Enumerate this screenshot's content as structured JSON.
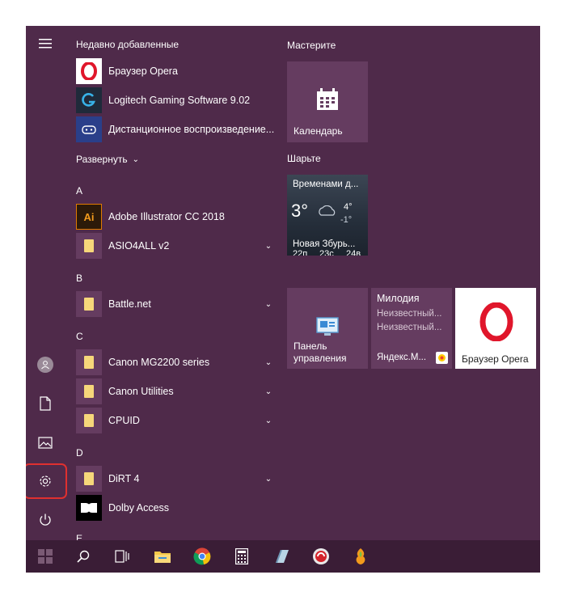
{
  "recent": {
    "heading": "Недавно добавленные",
    "items": [
      {
        "label": "Браузер Opera"
      },
      {
        "label": "Logitech Gaming Software 9.02"
      },
      {
        "label": "Дистанционное воспроизведение..."
      }
    ]
  },
  "expand_label": "Развернуть",
  "sections": [
    {
      "letter": "A",
      "items": [
        {
          "label": "Adobe Illustrator CC 2018"
        },
        {
          "label": "ASIO4ALL v2"
        }
      ]
    },
    {
      "letter": "B",
      "items": [
        {
          "label": "Battle.net"
        }
      ]
    },
    {
      "letter": "C",
      "items": [
        {
          "label": "Canon MG2200 series"
        },
        {
          "label": "Canon Utilities"
        },
        {
          "label": "CPUID"
        }
      ]
    },
    {
      "letter": "D",
      "items": [
        {
          "label": "DiRT 4"
        },
        {
          "label": "Dolby Access"
        }
      ]
    },
    {
      "letter": "E",
      "items": []
    }
  ],
  "tiles": {
    "group1": "Мастерите",
    "calendar_label": "Календарь",
    "group2": "Шарьте",
    "weather": {
      "title": "Временами д...",
      "temp": "3°",
      "high": "4°",
      "low": "-1°",
      "city": "Новая Збурь...",
      "days": [
        "22п",
        "23с",
        "24в"
      ]
    },
    "control_panel_label": "Панель управления",
    "music": {
      "title": "Милодия",
      "line1": "Неизвестный...",
      "line2": "Неизвестный...",
      "app": "Яндекс.М..."
    },
    "opera_label": "Браузер Opera"
  },
  "colors": {
    "menu_bg": "#4f2a4a",
    "tile_bg": "#653c60",
    "taskbar_bg": "#3a1d36",
    "highlight": "#e0302f",
    "opera_red": "#e0162b"
  }
}
